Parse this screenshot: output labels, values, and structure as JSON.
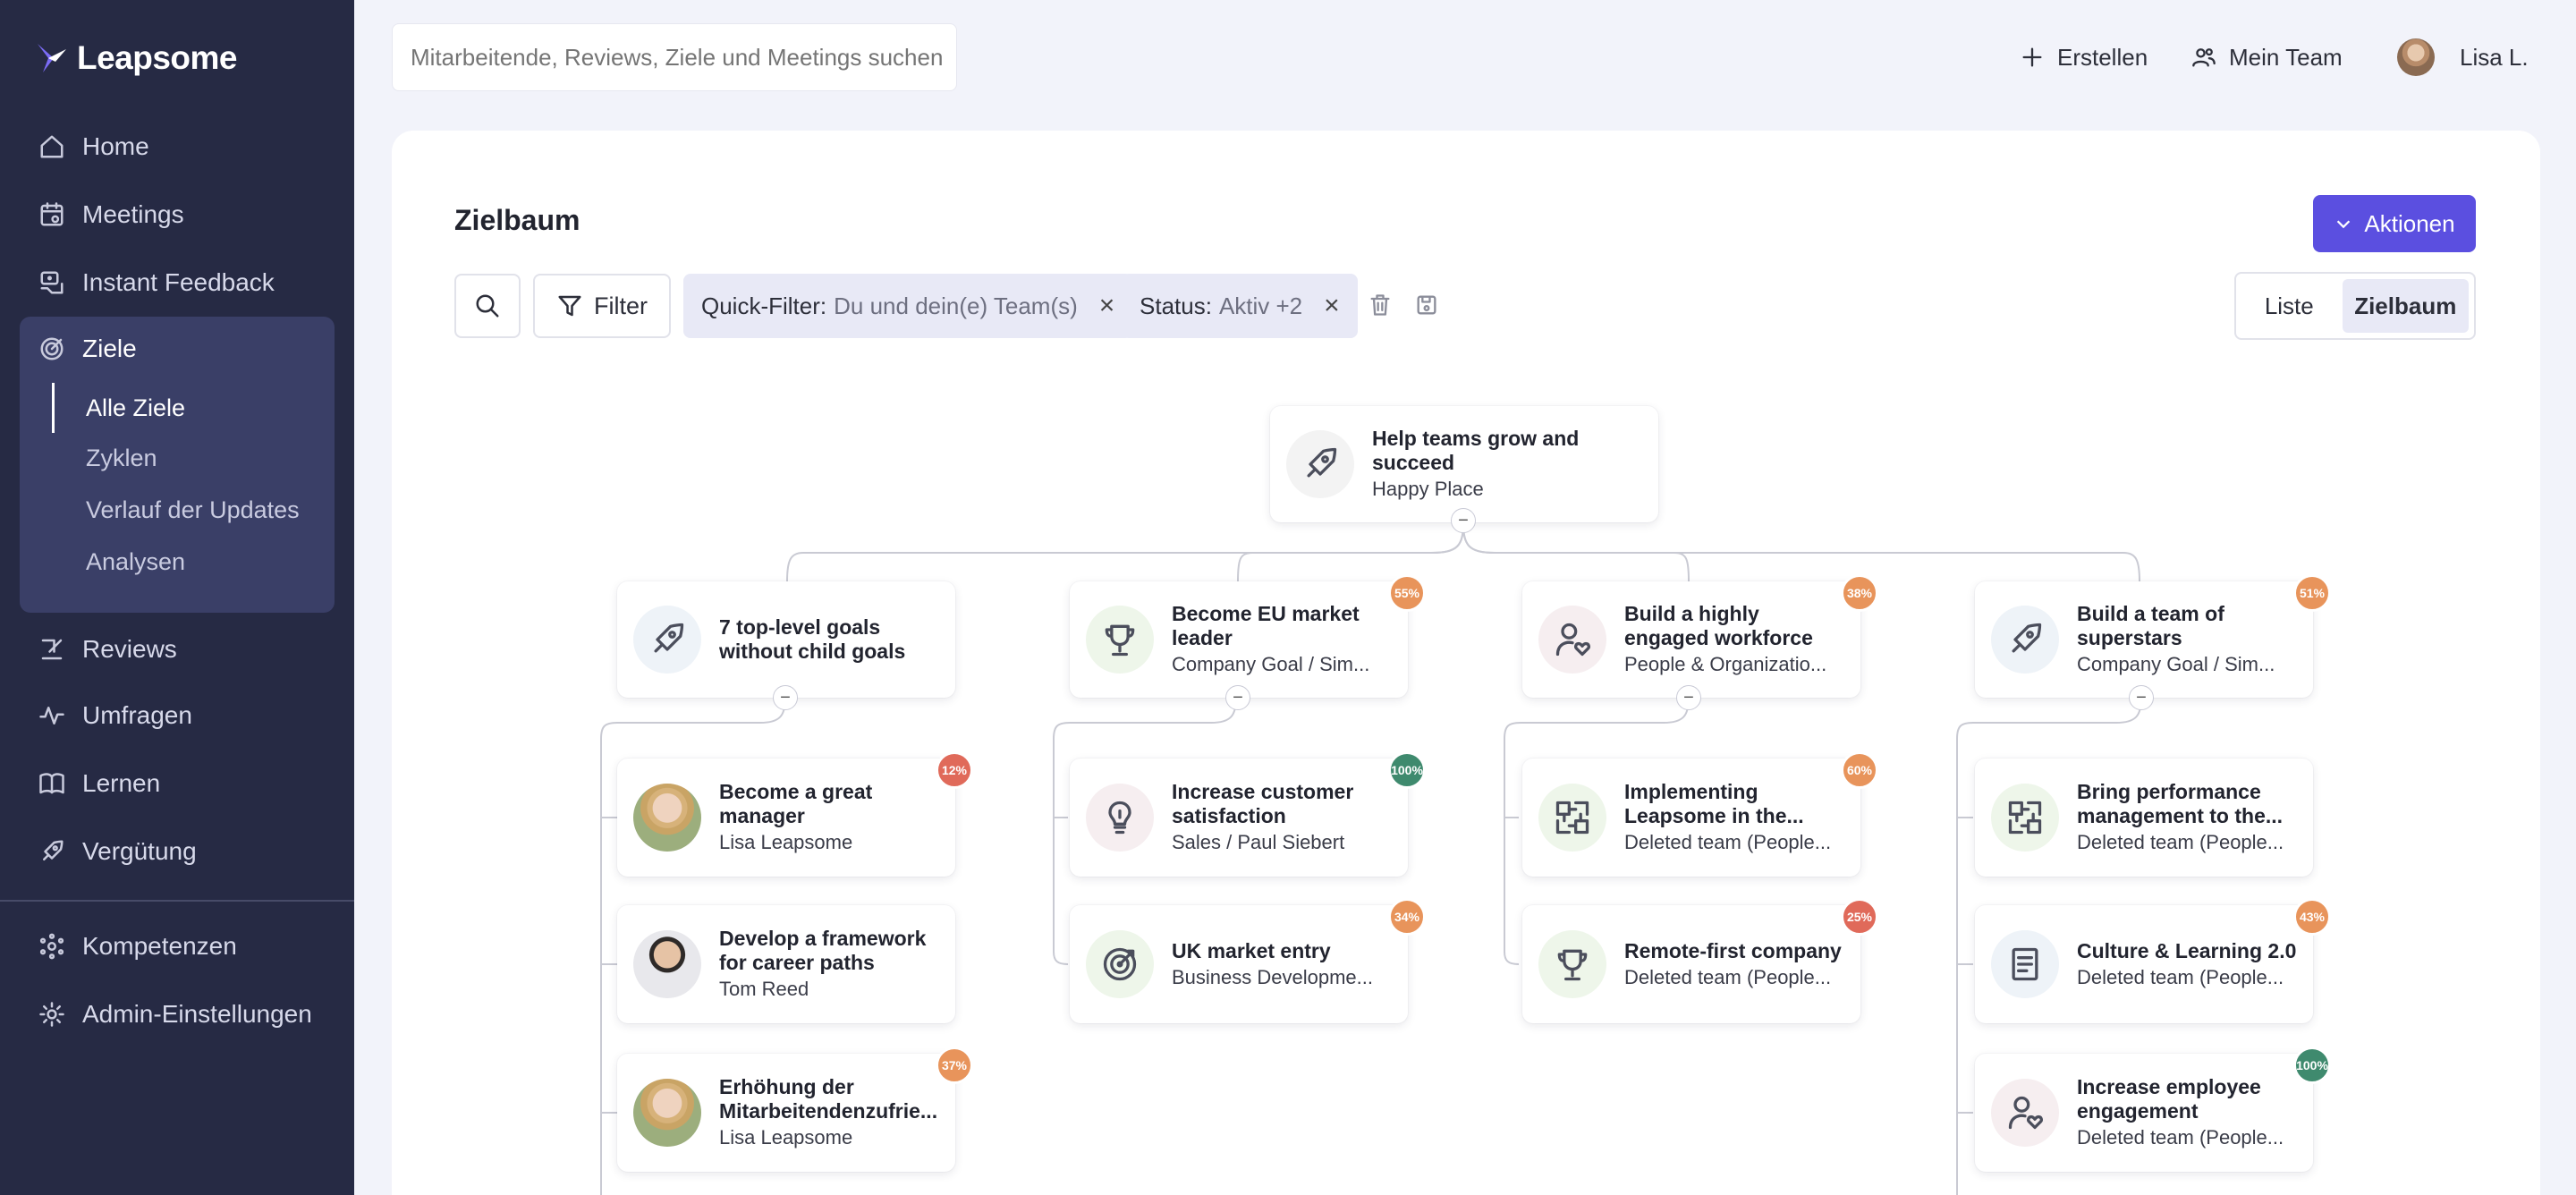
{
  "app": {
    "name": "Leapsome"
  },
  "sidebar": {
    "items": [
      {
        "label": "Home",
        "icon": "home-icon"
      },
      {
        "label": "Meetings",
        "icon": "calendar-icon"
      },
      {
        "label": "Instant Feedback",
        "icon": "feedback-icon"
      },
      {
        "label": "Ziele",
        "icon": "target-icon"
      },
      {
        "label": "Reviews",
        "icon": "edit-icon"
      },
      {
        "label": "Umfragen",
        "icon": "pulse-icon"
      },
      {
        "label": "Lernen",
        "icon": "book-icon"
      },
      {
        "label": "Vergütung",
        "icon": "rocket-icon"
      },
      {
        "label": "Kompetenzen",
        "icon": "network-icon"
      },
      {
        "label": "Admin-Einstellungen",
        "icon": "gear-icon"
      }
    ],
    "sub_items": [
      {
        "label": "Alle Ziele"
      },
      {
        "label": "Zyklen"
      },
      {
        "label": "Verlauf der Updates"
      },
      {
        "label": "Analysen"
      }
    ]
  },
  "header": {
    "search_placeholder": "Mitarbeitende, Reviews, Ziele und Meetings suchen",
    "create_label": "Erstellen",
    "team_label": "Mein Team",
    "user_label": "Lisa L."
  },
  "page": {
    "title": "Zielbaum",
    "actions_label": "Aktionen",
    "filter_label": "Filter",
    "chips": [
      {
        "key": "Quick-Filter:",
        "value": "Du und dein(e) Team(s)"
      },
      {
        "key": "Status:",
        "value": "Aktiv +2"
      }
    ],
    "view_options": [
      "Liste",
      "Zielbaum"
    ],
    "selected_view": "Zielbaum"
  },
  "colors": {
    "sidebar_bg": "#262a44",
    "accent": "#5b4fe0",
    "badge_orange": "#e8945b",
    "badge_red": "#e06a5a",
    "badge_green": "#3f8a6e"
  },
  "tree": {
    "root": {
      "title": "Help teams grow and succeed",
      "subtitle": "Happy Place",
      "icon": "rocket-icon"
    },
    "columns": [
      {
        "parent": {
          "title": "7 top-level goals without child goals",
          "subtitle": "",
          "icon": "rocket-icon",
          "progress": null
        },
        "children": [
          {
            "title": "Become a great manager",
            "subtitle": "Lisa Leapsome",
            "icon": "avatar-lisa",
            "progress": "12%"
          },
          {
            "title": "Develop a framework for career paths",
            "subtitle": "Tom Reed",
            "icon": "avatar-tom",
            "progress": null
          },
          {
            "title": "Erhöhung der Mitarbeitendenzufrie...",
            "subtitle": "Lisa Leapsome",
            "icon": "avatar-lisa",
            "progress": "37%"
          }
        ]
      },
      {
        "parent": {
          "title": "Become EU market leader",
          "subtitle": "Company Goal / Sim...",
          "icon": "trophy-icon",
          "progress": "55%"
        },
        "children": [
          {
            "title": "Increase customer satisfaction",
            "subtitle": "Sales / Paul Siebert",
            "icon": "lightbulb-icon",
            "progress": "100%"
          },
          {
            "title": "UK market entry",
            "subtitle": "Business Developme...",
            "icon": "target-icon",
            "progress": "34%"
          }
        ]
      },
      {
        "parent": {
          "title": "Build a highly engaged workforce",
          "subtitle": "People & Organizatio...",
          "icon": "person-heart-icon",
          "progress": "38%"
        },
        "children": [
          {
            "title": "Implementing Leapsome in the...",
            "subtitle": "Deleted team (People...",
            "icon": "puzzle-icon",
            "progress": "60%"
          },
          {
            "title": "Remote-first company",
            "subtitle": "Deleted team (People...",
            "icon": "trophy-icon",
            "progress": "25%"
          }
        ]
      },
      {
        "parent": {
          "title": "Build a team of superstars",
          "subtitle": "Company Goal / Sim...",
          "icon": "rocket-icon",
          "progress": "51%"
        },
        "children": [
          {
            "title": "Bring performance management to the...",
            "subtitle": "Deleted team (People...",
            "icon": "puzzle-icon",
            "progress": null
          },
          {
            "title": "Culture & Learning 2.0",
            "subtitle": "Deleted team (People...",
            "icon": "document-icon",
            "progress": "43%"
          },
          {
            "title": "Increase employee engagement",
            "subtitle": "Deleted team (People...",
            "icon": "person-heart-icon",
            "progress": "100%"
          }
        ]
      }
    ]
  }
}
